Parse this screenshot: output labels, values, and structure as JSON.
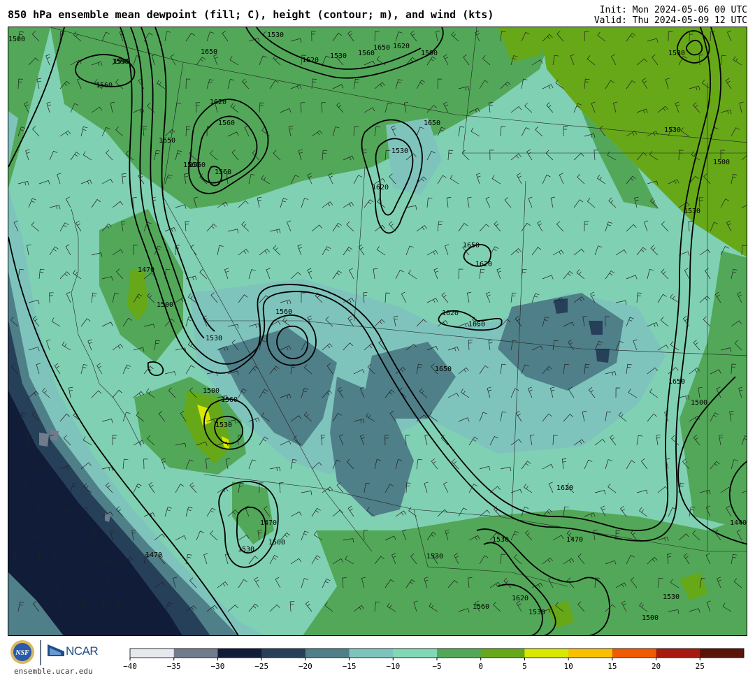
{
  "header": {
    "title": "850 hPa ensemble mean dewpoint (fill; C), height (contour; m), and wind (kts)",
    "init": "Init: Mon 2024-05-06 00 UTC",
    "valid": "Valid: Thu 2024-05-09 12 UTC"
  },
  "map": {
    "fill_variable": "dewpoint",
    "fill_units": "C",
    "contour_variable": "height",
    "contour_units": "m",
    "barb_variable": "wind",
    "barb_units": "kts",
    "contour_labels": [
      "1590",
      "1560",
      "1530",
      "1650",
      "1620",
      "1650",
      "1530",
      "1560",
      "1620",
      "1590",
      "1500",
      "1560",
      "1620",
      "1560",
      "1650",
      "1560",
      "1530",
      "1650",
      "1620",
      "1470",
      "1500",
      "1590",
      "1560",
      "1530",
      "1650",
      "1620",
      "1650",
      "1620",
      "1560",
      "1530",
      "1500",
      "1560",
      "1530",
      "1650",
      "1470",
      "1620",
      "1470",
      "1530",
      "1500",
      "1470",
      "1530",
      "1530",
      "1560",
      "1620",
      "1530",
      "1500",
      "1530",
      "1440",
      "1650",
      "1530",
      "1500",
      "1530",
      "1500"
    ]
  },
  "colorbar": {
    "ticks": [
      "−40",
      "−35",
      "−30",
      "−25",
      "−20",
      "−15",
      "−10",
      "−5",
      "0",
      "5",
      "10",
      "15",
      "20",
      "25"
    ],
    "colors": [
      "#e5e9ee",
      "#707c8c",
      "#111c38",
      "#27405a",
      "#4f7f88",
      "#7ec4bc",
      "#80d8b4",
      "#52a858",
      "#66a818",
      "#d8e800",
      "#f8c000",
      "#f05a00",
      "#a81a10",
      "#5a1408"
    ]
  },
  "branding": {
    "seal_text": "NSF",
    "org": "NCAR",
    "url": "ensemble.ucar.edu"
  }
}
